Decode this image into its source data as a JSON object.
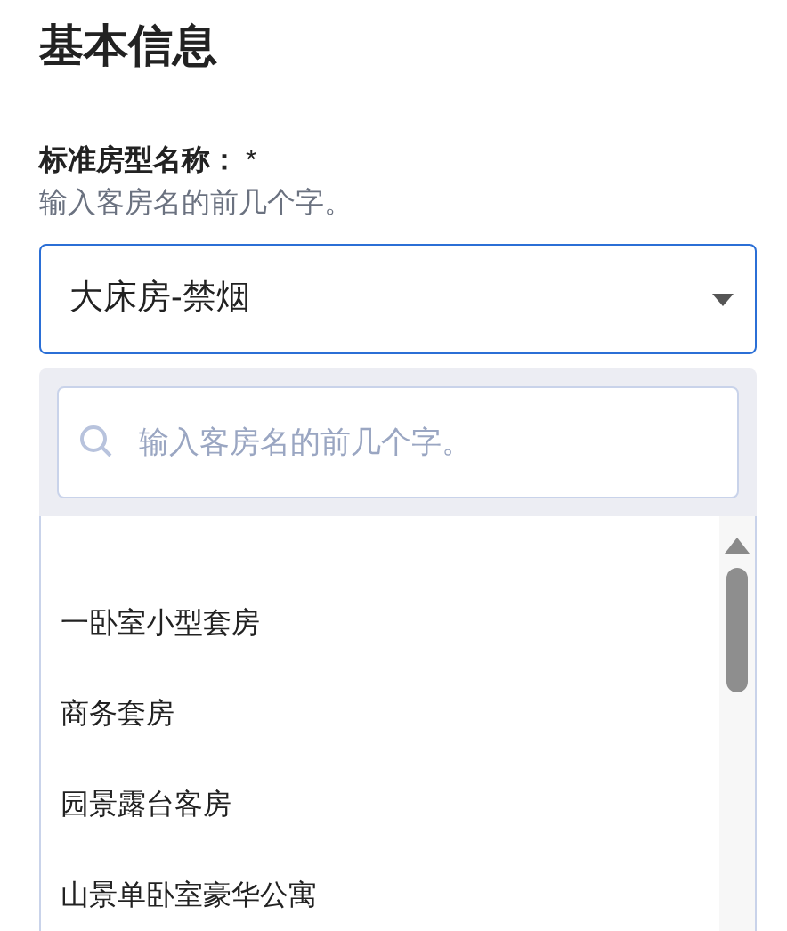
{
  "section_title": "基本信息",
  "field": {
    "label": "标准房型名称：",
    "required_mark": "*",
    "hint": "输入客房名的前几个字。",
    "value": "大床房-禁烟"
  },
  "dropdown": {
    "search_placeholder": "输入客房名的前几个字。",
    "options": [
      {
        "label": "一卧室小型套房"
      },
      {
        "label": "商务套房"
      },
      {
        "label": "园景露台客房"
      },
      {
        "label": "山景单卧室豪华公寓"
      }
    ]
  }
}
